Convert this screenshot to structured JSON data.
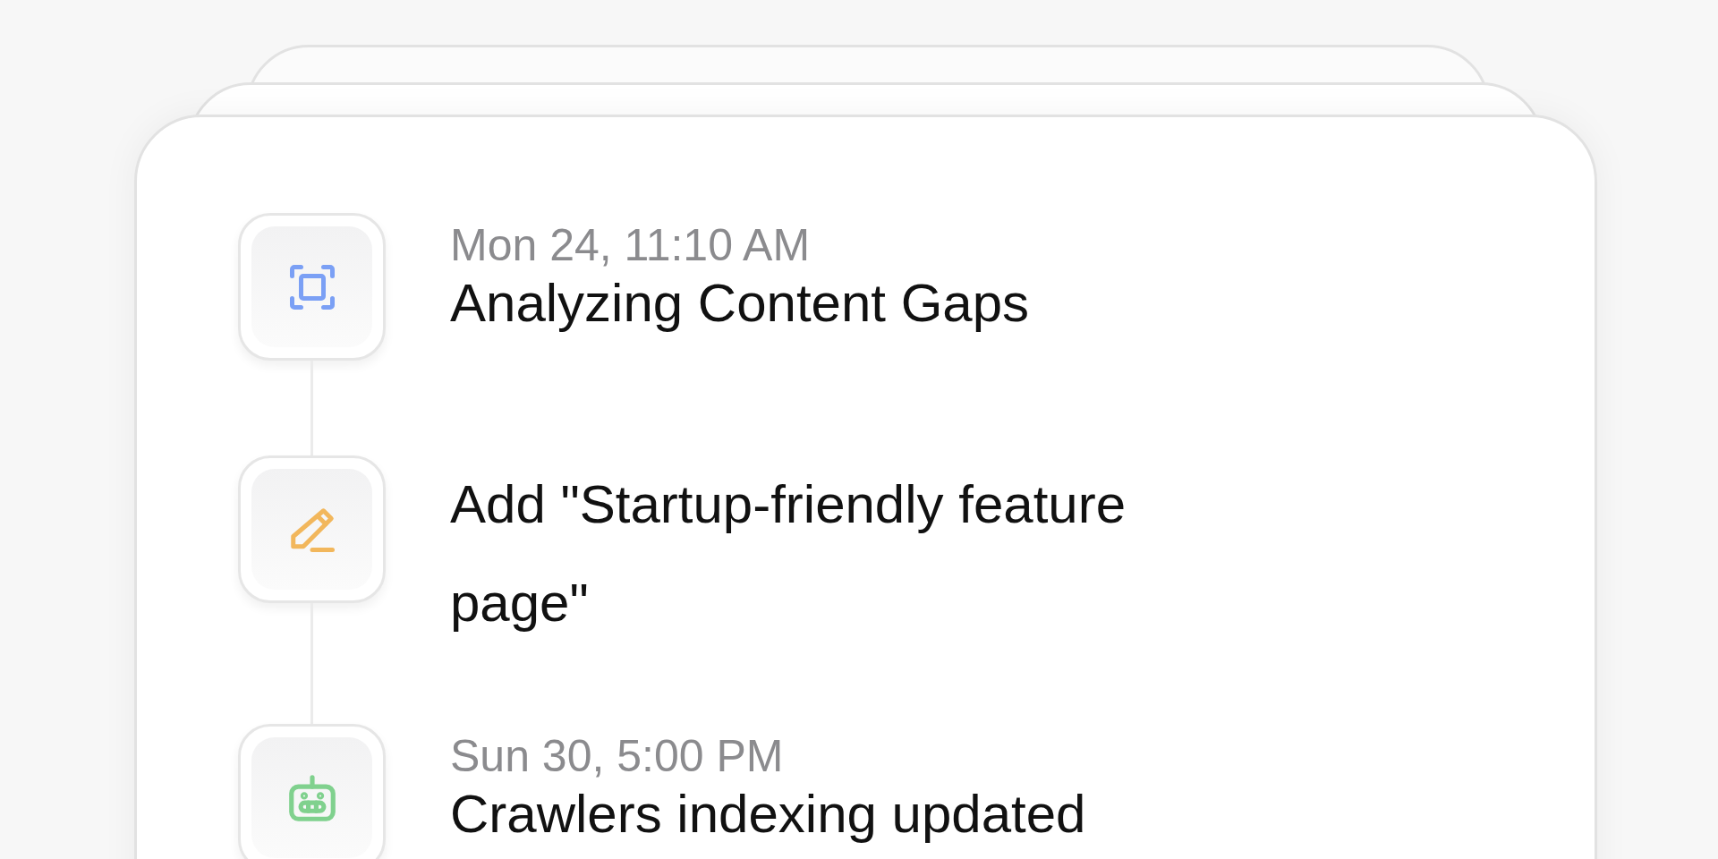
{
  "timeline": [
    {
      "kind": "scan",
      "color": "#7ba0f5",
      "timestamp": "Mon 24, 11:10 AM",
      "title": "Analyzing Content Gaps"
    },
    {
      "kind": "edit",
      "color": "#f2b75c",
      "title": "Add \"Startup-friendly feature page\""
    },
    {
      "kind": "crawler",
      "color": "#80d18e",
      "timestamp": "Sun 30, 5:00 PM",
      "title": "Crawlers indexing updated"
    }
  ]
}
